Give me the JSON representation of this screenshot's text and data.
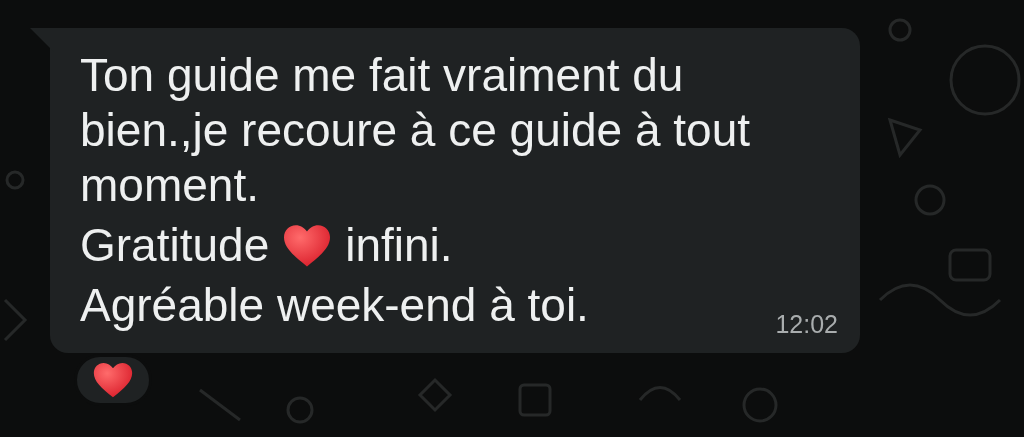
{
  "message": {
    "lines": [
      {
        "kind": "text",
        "text": "Ton guide me fait vraiment du bien.,je recoure à ce guide à tout moment."
      },
      {
        "kind": "heart_line",
        "before": "Gratitude",
        "after": "infini."
      },
      {
        "kind": "text",
        "text": "Agréable week-end à toi."
      }
    ],
    "time": "12:02"
  },
  "reaction": {
    "kind": "heart"
  }
}
